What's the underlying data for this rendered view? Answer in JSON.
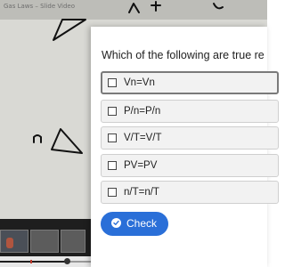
{
  "video": {
    "title": "Gas Laws – Slide Video"
  },
  "quiz": {
    "question": "Which of the following are true re",
    "options": [
      {
        "label": "Vn=Vn"
      },
      {
        "label": "P/n=P/n"
      },
      {
        "label": "V/T=V/T"
      },
      {
        "label": "PV=PV"
      },
      {
        "label": "n/T=n/T"
      }
    ],
    "check_label": "Check"
  },
  "player": {
    "progress": 0.25
  },
  "colors": {
    "accent": "#2a6fd8",
    "marker": "#c0392b"
  }
}
